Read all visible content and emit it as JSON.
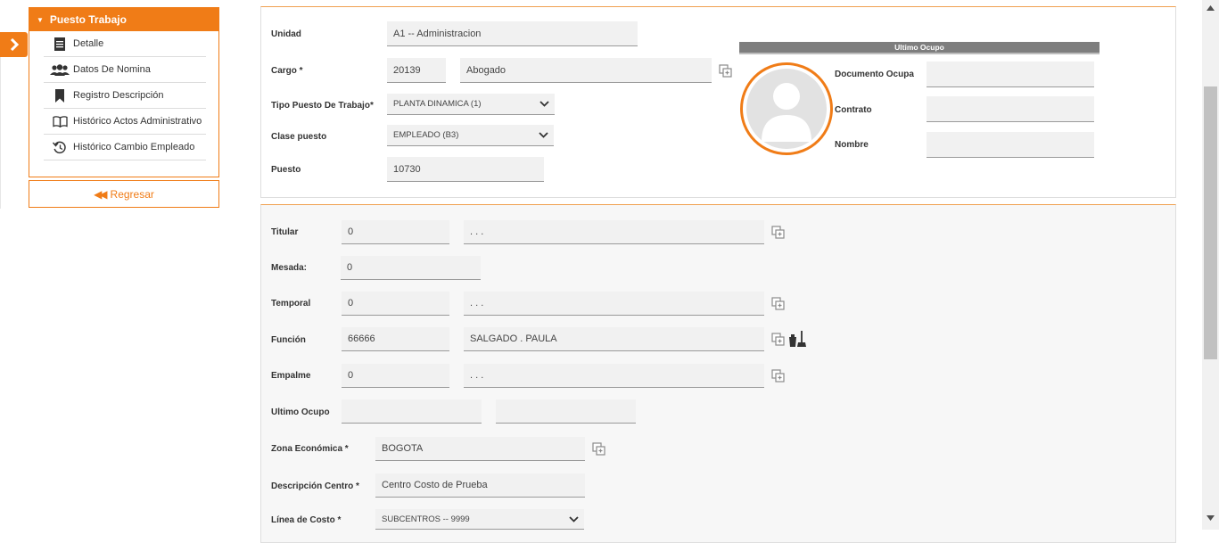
{
  "sidebar": {
    "title": "Puesto Trabajo",
    "items": [
      {
        "label": "Detalle",
        "icon": "document-icon"
      },
      {
        "label": "Datos De Nomina",
        "icon": "users-icon"
      },
      {
        "label": "Registro Descripción",
        "icon": "bookmark-icon"
      },
      {
        "label": "Histórico Actos Administrativo",
        "icon": "book-icon"
      },
      {
        "label": "Histórico Cambio Empleado",
        "icon": "history-icon"
      }
    ],
    "back_label": "Regresar"
  },
  "top": {
    "unidad": {
      "label": "Unidad",
      "value": "A1          -- Administracion"
    },
    "cargo": {
      "label": "Cargo *",
      "code": "20139",
      "name": "Abogado"
    },
    "tipo_puesto": {
      "label": "Tipo Puesto De Trabajo*",
      "value": "PLANTA DINAMICA (1)"
    },
    "clase_puesto": {
      "label": "Clase puesto",
      "value": "EMPLEADO (B3)"
    },
    "puesto": {
      "label": "Puesto",
      "value": "10730"
    },
    "ultimo_ocupo": {
      "title": "Ultimo Ocupo",
      "documento_label": "Documento Ocupa",
      "documento_value": "",
      "contrato_label": "Contrato",
      "contrato_value": "",
      "nombre_label": "Nombre",
      "nombre_value": ""
    }
  },
  "bottom": {
    "titular": {
      "label": "Titular",
      "code": "0",
      "name": ". . ."
    },
    "mesada": {
      "label": "Mesada:",
      "value": "0"
    },
    "temporal": {
      "label": "Temporal",
      "code": "0",
      "name": ". . ."
    },
    "funcion": {
      "label": "Función",
      "code": "66666",
      "name": "SALGADO . PAULA"
    },
    "empalme": {
      "label": "Empalme",
      "code": "0",
      "name": ". . ."
    },
    "ultimo_ocupo": {
      "label": "Ultimo Ocupo",
      "code": "",
      "name": ""
    },
    "zona": {
      "label": "Zona Económica *",
      "value": "BOGOTA"
    },
    "descripcion_centro": {
      "label": "Descripción Centro *",
      "value": "Centro Costo de Prueba"
    },
    "linea_costo": {
      "label": "Línea de Costo *",
      "value": "SUBCENTROS -- 9999"
    }
  },
  "colors": {
    "accent": "#f07c17",
    "field_bg": "#f1f1f1",
    "header_gray": "#7e7e7e"
  }
}
